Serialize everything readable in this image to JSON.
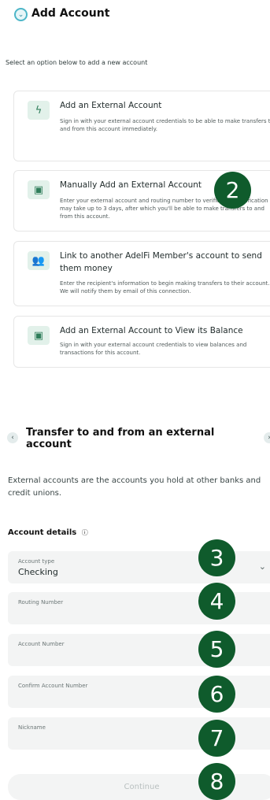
{
  "header": {
    "title": "Add Account",
    "subtitle": "Select an option below to add a new account"
  },
  "options": [
    {
      "title": "Add an External Account",
      "desc": "Sign in with your external account credentials to be able to make transfers to and from this account immediately.",
      "icon": "bolt-icon"
    },
    {
      "title": "Manually Add an External Account",
      "desc": "Enter your external account and routing number to verification. Verification may take up to 3 days, after which you'll be able to make transfers to and from this account.",
      "icon": "wallet-icon"
    },
    {
      "title": "Link to another AdelFi Member's account to send them money",
      "desc": "Enter the recipient's information to begin making transfers to their account. We will notify them by email of this connection.",
      "icon": "people-icon"
    },
    {
      "title": "Add an External Account to View its Balance",
      "desc": "Sign in with your external account credentials to view balances and transactions for this account.",
      "icon": "wallet-icon"
    }
  ],
  "transfer": {
    "title": "Transfer to and from an external account",
    "intro": "External accounts are the accounts you hold at other banks and credit unions.",
    "details_label": "Account details",
    "info_icon": "ⓘ"
  },
  "form": {
    "account_type_label": "Account type",
    "account_type_value": "Checking",
    "routing_label": "Routing Number",
    "account_number_label": "Account Number",
    "confirm_label": "Confirm Account Number",
    "nickname_label": "Nickname",
    "continue_label": "Continue"
  },
  "badges": [
    "2",
    "3",
    "4",
    "5",
    "6",
    "7",
    "8"
  ],
  "colors": {
    "badge": "#0f5b2c",
    "accent": "#4db6c8",
    "icon_bg": "#e2f1ea"
  }
}
